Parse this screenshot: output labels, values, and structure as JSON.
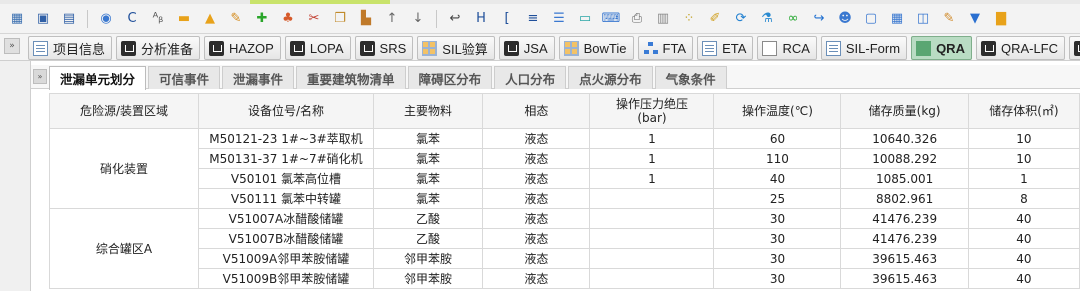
{
  "toolbar": {
    "icons": [
      "grid-icon",
      "save-icon",
      "save-as-icon",
      "globe-icon",
      "refresh-icon",
      "abc-icon",
      "folder-icon",
      "lock-icon",
      "pencil-icon",
      "add-icon",
      "person-icon",
      "cut-icon",
      "copy-icon",
      "paste-icon",
      "arrow-up-icon",
      "arrow-down-icon",
      "import-icon",
      "header-icon",
      "format-icon",
      "split-icon",
      "list-icon",
      "monitor-icon",
      "keyboard-icon",
      "printer-icon",
      "chart-icon",
      "dots-icon",
      "brush-icon",
      "sync-icon",
      "flask-icon",
      "link-icon",
      "redo-icon",
      "user-icon",
      "window-icon",
      "table-icon",
      "panel-icon",
      "edit-icon",
      "filter-icon",
      "bars-icon"
    ]
  },
  "module_tabs": [
    {
      "label": "项目信息",
      "icon": "doc"
    },
    {
      "label": "分析准备",
      "icon": "dark"
    },
    {
      "label": "HAZOP",
      "icon": "dark"
    },
    {
      "label": "LOPA",
      "icon": "dark"
    },
    {
      "label": "SRS",
      "icon": "dark"
    },
    {
      "label": "SIL验算",
      "icon": "grid4"
    },
    {
      "label": "JSA",
      "icon": "dark"
    },
    {
      "label": "BowTie",
      "icon": "grid4"
    },
    {
      "label": "FTA",
      "icon": "tree"
    },
    {
      "label": "ETA",
      "icon": "doc"
    },
    {
      "label": "RCA",
      "icon": "rca"
    },
    {
      "label": "SIL-Form",
      "icon": "doc"
    },
    {
      "label": "QRA",
      "icon": "green",
      "active": true
    },
    {
      "label": "QRA-LFC",
      "icon": "dark"
    },
    {
      "label": "SIL",
      "icon": "dark"
    }
  ],
  "sub_tabs": [
    {
      "label": "泄漏单元划分",
      "active": true
    },
    {
      "label": "可信事件"
    },
    {
      "label": "泄漏事件"
    },
    {
      "label": "重要建筑物清单"
    },
    {
      "label": "障碍区分布"
    },
    {
      "label": "人口分布"
    },
    {
      "label": "点火源分布"
    },
    {
      "label": "气象条件"
    }
  ],
  "table": {
    "headers": [
      "危险源/装置区域",
      "设备位号/名称",
      "主要物料",
      "相态",
      "操作压力绝压\n(bar)",
      "操作温度(℃)",
      "储存质量(kg)",
      "储存体积(㎡)"
    ],
    "groups": [
      {
        "area": "硝化装置",
        "rows": [
          [
            "M50121-23 1#~3#萃取机",
            "氯苯",
            "液态",
            "1",
            "60",
            "10640.326",
            "10"
          ],
          [
            "M50131-37 1#~7#硝化机",
            "氯苯",
            "液态",
            "1",
            "110",
            "10088.292",
            "10"
          ],
          [
            "V50101 氯苯高位槽",
            "氯苯",
            "液态",
            "1",
            "40",
            "1085.001",
            "1"
          ],
          [
            "V50111 氯苯中转罐",
            "氯苯",
            "液态",
            "",
            "25",
            "8802.961",
            "8"
          ]
        ]
      },
      {
        "area": "综合罐区A",
        "rows": [
          [
            "V51007A冰醋酸储罐",
            "乙酸",
            "液态",
            "",
            "30",
            "41476.239",
            "40"
          ],
          [
            "V51007B冰醋酸储罐",
            "乙酸",
            "液态",
            "",
            "30",
            "41476.239",
            "40"
          ],
          [
            "V51009A邻甲苯胺储罐",
            "邻甲苯胺",
            "液态",
            "",
            "30",
            "39615.463",
            "40"
          ],
          [
            "V51009B邻甲苯胺储罐",
            "邻甲苯胺",
            "液态",
            "",
            "30",
            "39615.463",
            "40"
          ]
        ]
      }
    ]
  }
}
